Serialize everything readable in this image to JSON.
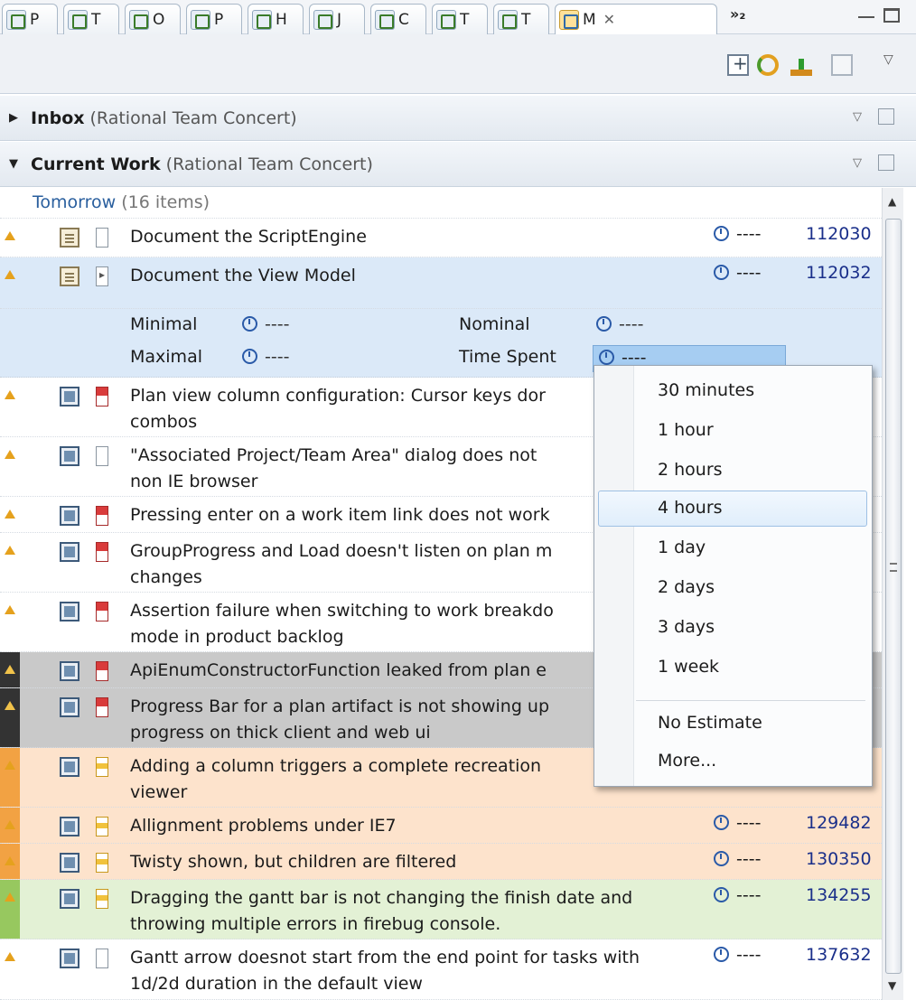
{
  "tabs": [
    {
      "label": "P"
    },
    {
      "label": "T"
    },
    {
      "label": "O"
    },
    {
      "label": "P"
    },
    {
      "label": "H"
    },
    {
      "label": "J"
    },
    {
      "label": "C"
    },
    {
      "label": "T"
    },
    {
      "label": "T"
    },
    {
      "label": "M",
      "active": true
    }
  ],
  "tabs_overflow": "»₂",
  "sections": {
    "inbox": {
      "title": "Inbox",
      "subtitle": "(Rational Team Concert)"
    },
    "current_work": {
      "title": "Current Work",
      "subtitle": "(Rational Team Concert)"
    }
  },
  "group": {
    "name": "Tomorrow",
    "count": "(16 items)"
  },
  "rows": [
    {
      "summary": "Document the ScriptEngine",
      "estimate": "----",
      "id": "112030"
    },
    {
      "summary": "Document the View Model",
      "estimate": "----",
      "id": "112032"
    },
    {
      "summary": "Plan view column configuration: Cursor keys dor",
      "summary2": "combos"
    },
    {
      "summary": "\"Associated Project/Team Area\" dialog does not",
      "summary2": "non IE browser"
    },
    {
      "summary": "Pressing enter on a work item link does not work"
    },
    {
      "summary": "GroupProgress and Load doesn't listen on plan m",
      "summary2": "changes"
    },
    {
      "summary": "Assertion failure when switching to work breakdo",
      "summary2": "mode in product backlog"
    },
    {
      "summary": "ApiEnumConstructorFunction leaked from plan e"
    },
    {
      "summary": "Progress Bar for a plan artifact is not showing up",
      "summary2": "progress on thick client and web ui"
    },
    {
      "summary": "Adding a column triggers a complete recreation",
      "summary2": "viewer"
    },
    {
      "summary": "Allignment problems under IE7",
      "estimate": "----",
      "id": "129482"
    },
    {
      "summary": "Twisty shown, but children are filtered",
      "estimate": "----",
      "id": "130350"
    },
    {
      "summary": "Dragging the gantt bar is not changing the finish date and",
      "summary2": "throwing multiple errors in firebug console.",
      "estimate": "----",
      "id": "134255"
    },
    {
      "summary": "Gantt arrow doesnot start from the end point for tasks with",
      "summary2": "1d/2d duration in the default view",
      "estimate": "----",
      "id": "137632"
    }
  ],
  "details": {
    "minimal_label": "Minimal",
    "minimal_value": "----",
    "nominal_label": "Nominal",
    "nominal_value": "----",
    "maximal_label": "Maximal",
    "maximal_value": "----",
    "time_spent_label": "Time Spent",
    "time_spent_value": "----"
  },
  "menu": {
    "items": [
      "30 minutes",
      "1 hour",
      "2 hours",
      "4 hours",
      "1 day",
      "2 days",
      "3 days",
      "1 week"
    ],
    "highlighted": "4 hours",
    "no_estimate": "No Estimate",
    "more": "More..."
  },
  "colors": {
    "selection": "#dbe9f8",
    "grey_row": "#c9c9c9",
    "peach_row": "#fde3cc",
    "green_row": "#e3f1d5",
    "id_link": "#1a2f8a",
    "group_header": "#2a5f9e"
  }
}
